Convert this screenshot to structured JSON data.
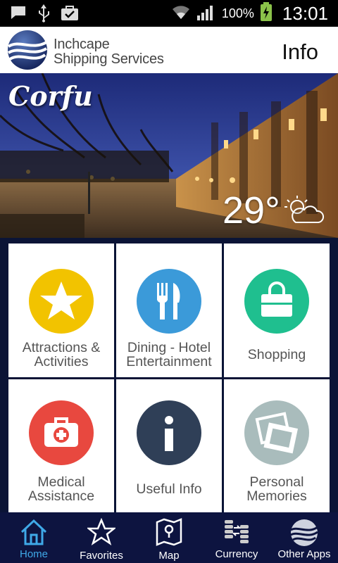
{
  "status_bar": {
    "battery_percent": "100%",
    "time": "13:01"
  },
  "header": {
    "brand_line1": "Inchcape",
    "brand_line2": "Shipping Services",
    "title": "Info"
  },
  "hero": {
    "city": "Corfu",
    "temperature": "29°"
  },
  "tiles": [
    {
      "label1": "Attractions &",
      "label2": "Activities",
      "color": "#f2c300"
    },
    {
      "label1": "Dining - Hotel",
      "label2": "Entertainment",
      "color": "#3b9ad9"
    },
    {
      "label1": "Shopping",
      "label2": "",
      "color": "#1fbf8f"
    },
    {
      "label1": "Medical",
      "label2": "Assistance",
      "color": "#e8483f"
    },
    {
      "label1": "Useful Info",
      "label2": "",
      "color": "#2f3f57"
    },
    {
      "label1": "Personal",
      "label2": "Memories",
      "color": "#a9bcbc"
    }
  ],
  "nav": [
    {
      "label": "Home",
      "active": true
    },
    {
      "label": "Favorites"
    },
    {
      "label": "Map"
    },
    {
      "label": "Currency"
    },
    {
      "label": "Other Apps"
    }
  ]
}
